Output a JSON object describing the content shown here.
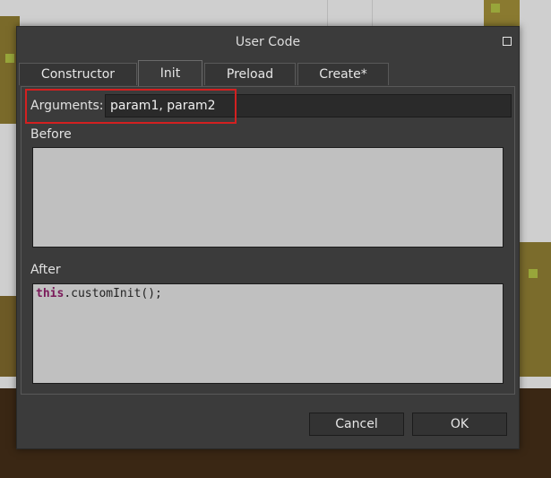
{
  "dialog": {
    "title": "User Code",
    "tabs": [
      {
        "label": "Constructor",
        "active": false
      },
      {
        "label": "Init",
        "active": true
      },
      {
        "label": "Preload",
        "active": false
      },
      {
        "label": "Create*",
        "active": false
      }
    ],
    "arguments": {
      "label": "Arguments:",
      "value": "param1, param2"
    },
    "before": {
      "label": "Before",
      "code": ""
    },
    "after": {
      "label": "After",
      "code_keyword": "this",
      "code_rest": ".customInit();"
    },
    "buttons": {
      "cancel": "Cancel",
      "ok": "OK"
    }
  },
  "colors": {
    "highlight": "#d32020",
    "keyword": "#7a1a5a"
  }
}
